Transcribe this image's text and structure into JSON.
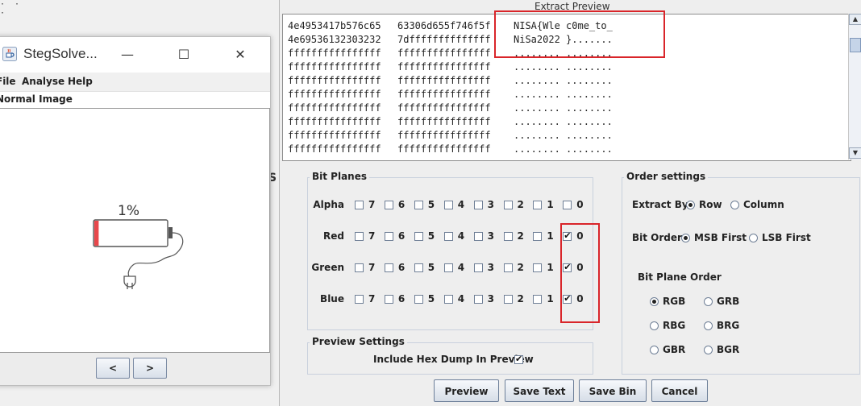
{
  "background_text": {
    "dots": "· · ·",
    "partial_char": "S"
  },
  "stegsolve": {
    "title": "StegSolve...",
    "minimize": "—",
    "maximize": "☐",
    "close": "✕",
    "menu": [
      "File",
      "Analyse",
      "Help"
    ],
    "image_label": "Normal Image",
    "battery_percent": "1%",
    "battery_level": 0.06,
    "prev_label": "<",
    "next_label": ">"
  },
  "extract": {
    "title": "Extract Preview",
    "hex_lines": [
      {
        "hex1": "4e4953417b576c65",
        "hex2": "63306d655f746f5f",
        "ascii": "NISA{Wle c0me_to_"
      },
      {
        "hex1": "4e69536132303232",
        "hex2": "7dffffffffffffff",
        "ascii": "NiSa2022 }......."
      },
      {
        "hex1": "ffffffffffffffff",
        "hex2": "ffffffffffffffff",
        "ascii": "........ ........"
      },
      {
        "hex1": "ffffffffffffffff",
        "hex2": "ffffffffffffffff",
        "ascii": "........ ........"
      },
      {
        "hex1": "ffffffffffffffff",
        "hex2": "ffffffffffffffff",
        "ascii": "........ ........"
      },
      {
        "hex1": "ffffffffffffffff",
        "hex2": "ffffffffffffffff",
        "ascii": "........ ........"
      },
      {
        "hex1": "ffffffffffffffff",
        "hex2": "ffffffffffffffff",
        "ascii": "........ ........"
      },
      {
        "hex1": "ffffffffffffffff",
        "hex2": "ffffffffffffffff",
        "ascii": "........ ........"
      },
      {
        "hex1": "ffffffffffffffff",
        "hex2": "ffffffffffffffff",
        "ascii": "........ ........"
      },
      {
        "hex1": "ffffffffffffffff",
        "hex2": "ffffffffffffffff",
        "ascii": "........ ........"
      }
    ],
    "bit_planes": {
      "label": "Bit Planes",
      "bits": [
        "7",
        "6",
        "5",
        "4",
        "3",
        "2",
        "1",
        "0"
      ],
      "rows": [
        {
          "name": "Alpha",
          "checked": [
            false,
            false,
            false,
            false,
            false,
            false,
            false,
            false
          ]
        },
        {
          "name": "Red",
          "checked": [
            false,
            false,
            false,
            false,
            false,
            false,
            false,
            true
          ]
        },
        {
          "name": "Green",
          "checked": [
            false,
            false,
            false,
            false,
            false,
            false,
            false,
            true
          ]
        },
        {
          "name": "Blue",
          "checked": [
            false,
            false,
            false,
            false,
            false,
            false,
            false,
            true
          ]
        }
      ]
    },
    "preview_settings": {
      "label": "Preview Settings",
      "include_hex_label": "Include Hex Dump In Preview",
      "include_hex": true
    },
    "order_settings": {
      "label": "Order settings",
      "extract_by_label": "Extract By",
      "extract_by_options": [
        "Row",
        "Column"
      ],
      "extract_by_selected": "Row",
      "bit_order_label": "Bit Order",
      "bit_order_options": [
        "MSB First",
        "LSB First"
      ],
      "bit_order_selected": "MSB First",
      "bit_plane_order_label": "Bit Plane Order",
      "bit_plane_order_options": [
        "RGB",
        "GRB",
        "RBG",
        "BRG",
        "GBR",
        "BGR"
      ],
      "bit_plane_order_selected": "RGB"
    },
    "buttons": {
      "preview": "Preview",
      "save_text": "Save Text",
      "save_bin": "Save Bin",
      "cancel": "Cancel"
    }
  },
  "colors": {
    "highlight_red": "#d9252a",
    "battery_red": "#e8474b"
  }
}
